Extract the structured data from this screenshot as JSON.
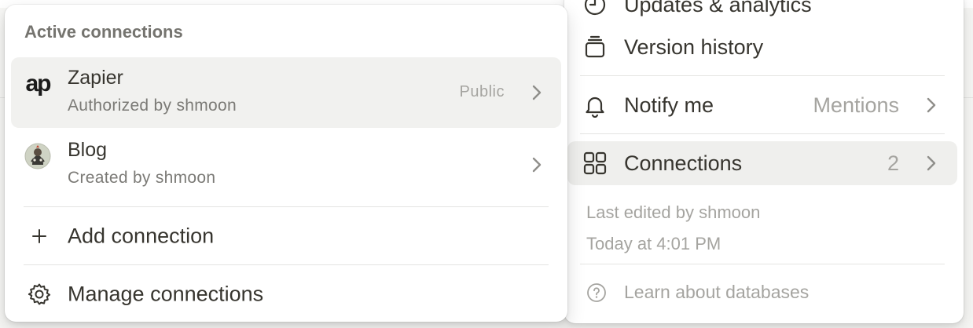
{
  "main_menu": {
    "items": [
      {
        "label": "Updates & analytics",
        "icon": "clock-icon"
      },
      {
        "label": "Version history",
        "icon": "stack-icon"
      },
      {
        "label": "Notify me",
        "value": "Mentions",
        "icon": "bell-icon"
      },
      {
        "label": "Connections",
        "value": "2",
        "icon": "grid-icon"
      }
    ],
    "meta": {
      "edited_by": "Last edited by shmoon",
      "edited_at": "Today at 4:01 PM"
    },
    "learn_link": "Learn about databases"
  },
  "submenu": {
    "heading": "Active connections",
    "connections": [
      {
        "name": "Zapier",
        "subtitle": "Authorized by shmoon",
        "badge": "Public",
        "logo_text": "ap"
      },
      {
        "name": "Blog",
        "subtitle": "Created by shmoon",
        "badge": ""
      }
    ],
    "actions": [
      {
        "label": "Add connection",
        "icon": "plus-icon"
      },
      {
        "label": "Manage connections",
        "icon": "gear-icon"
      }
    ]
  },
  "colors": {
    "text": "#37352f",
    "muted": "#a5a4a0",
    "hover": "#efefed",
    "border": "#e4e4e2"
  }
}
